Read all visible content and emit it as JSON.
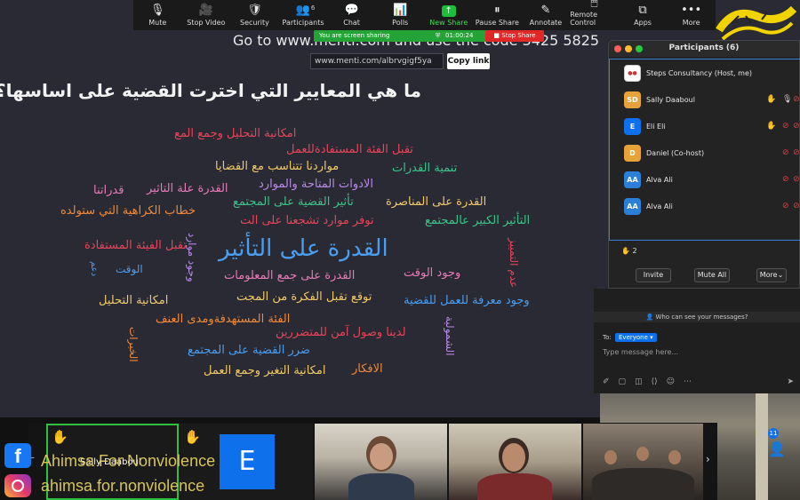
{
  "toolbar": {
    "items": [
      {
        "label": "Mute",
        "icon": "microphone-icon",
        "glyph": "🎙"
      },
      {
        "label": "Stop Video",
        "icon": "video-camera-icon",
        "glyph": "🎥"
      },
      {
        "label": "Security",
        "icon": "shield-icon",
        "glyph": "🛡"
      },
      {
        "label": "Participants",
        "icon": "participants-icon",
        "glyph": "👥",
        "badge": "6"
      },
      {
        "label": "Chat",
        "icon": "chat-bubble-icon",
        "glyph": "💬"
      },
      {
        "label": "Polls",
        "icon": "polls-icon",
        "glyph": "📊"
      },
      {
        "label": "New Share",
        "icon": "share-screen-icon",
        "glyph": "↑"
      },
      {
        "label": "Pause Share",
        "icon": "pause-icon",
        "glyph": "⏸"
      },
      {
        "label": "Annotate",
        "icon": "pencil-icon",
        "glyph": "✎"
      },
      {
        "label": "Remote Control",
        "icon": "remote-control-icon",
        "glyph": "🖱"
      },
      {
        "label": "Apps",
        "icon": "apps-icon",
        "glyph": "⧉"
      },
      {
        "label": "More",
        "icon": "more-dots-icon",
        "glyph": "•••"
      }
    ]
  },
  "share_bar": {
    "text": "You are screen sharing",
    "timer": "01:00:24",
    "stop_label": "Stop Share"
  },
  "slide": {
    "header": "Go to www.menti.com and use the code 3425 5825",
    "url": "www.menti.com/albrvgigf5ya",
    "copy_label": "Copy link",
    "question": "ما هي المعايير التي اخترت القضية على اساسها؟",
    "words": [
      {
        "text": "القدرة على التأثير",
        "color": "#4a9ef0"
      },
      {
        "text": "امكانية التحليل وجمع المع",
        "color": "#e8455a"
      },
      {
        "text": "تقبل الفئة المستفادةللعمل",
        "color": "#e8455a"
      },
      {
        "text": "مواردنا تتناسب مع القضايا",
        "color": "#f0c96a"
      },
      {
        "text": "تنمية القدرات",
        "color": "#3ec28a"
      },
      {
        "text": "الادوات المتاحة والموارد",
        "color": "#b88ae8"
      },
      {
        "text": "القدرة علة التاثير",
        "color": "#e87ab8"
      },
      {
        "text": "قدراتنا",
        "color": "#e87ab8"
      },
      {
        "text": "تأثير القضية على المجتمع",
        "color": "#3ec28a"
      },
      {
        "text": "القدرة على المناصرة",
        "color": "#f0c96a"
      },
      {
        "text": "خطاب الكراهية التي ستولده",
        "color": "#f08a3a"
      },
      {
        "text": "توفر موارد تشجعنا على الت",
        "color": "#e8455a"
      },
      {
        "text": "التأثير الكبير عالمجتمع",
        "color": "#3ec28a"
      },
      {
        "text": "القدرة على التأثير",
        "color": "#4a9ef0"
      },
      {
        "text": "تقبل الفيئة المستفادة",
        "color": "#e8455a"
      },
      {
        "text": "وجود موارد",
        "color": "#b88ae8"
      },
      {
        "text": "عدم التمييز",
        "color": "#e8455a"
      },
      {
        "text": "الوقت",
        "color": "#4a9ef0"
      },
      {
        "text": "دعم",
        "color": "#4a9ef0"
      },
      {
        "text": "القدرة على جمع المعلومات",
        "color": "#e87ab8"
      },
      {
        "text": "وجود الوقت",
        "color": "#e87ab8"
      },
      {
        "text": "امكانية التحليل",
        "color": "#f0c96a"
      },
      {
        "text": "توقع تقبل الفكرة من المجت",
        "color": "#f0c96a"
      },
      {
        "text": "وجود معرفة للعمل للقضية",
        "color": "#4a9ef0"
      },
      {
        "text": "الفئة المستهدفةومدى العنف",
        "color": "#f08a3a"
      },
      {
        "text": "لدينا وصول آمن للمتضررين",
        "color": "#e8455a"
      },
      {
        "text": "الشمولية",
        "color": "#b88ae8"
      },
      {
        "text": "الخبرات",
        "color": "#f08a3a"
      },
      {
        "text": "ضرر القضية على المجتمع",
        "color": "#4a9ef0"
      },
      {
        "text": "امكانية التغير وجمع العمل",
        "color": "#f0c96a"
      },
      {
        "text": "الافكار",
        "color": "#f08a3a"
      }
    ]
  },
  "participants": {
    "title": "Participants (6)",
    "list": [
      {
        "name": "Steps Consultancy (Host, me)",
        "initials": "",
        "color": "#ffffff"
      },
      {
        "name": "Sally Daaboul",
        "initials": "SD",
        "color": "#e8a23a"
      },
      {
        "name": "Eli Eli",
        "initials": "E",
        "color": "#0e71eb"
      },
      {
        "name": "Daniel (Co-host)",
        "initials": "D",
        "color": "#e8a23a"
      },
      {
        "name": "Alva Ali",
        "initials": "AA",
        "color": "#2b7fd6"
      },
      {
        "name": "Alva Ali",
        "initials": "AA",
        "color": "#2b7fd6"
      }
    ],
    "raised_count": "2",
    "invite_label": "Invite",
    "mute_all_label": "Mute All",
    "more_label": "More"
  },
  "chat": {
    "visibility": "Who can see your messages?",
    "to_label": "To:",
    "recipient": "Everyone",
    "placeholder": "Type message here..."
  },
  "video": {
    "sally_name": "Sally Daaboul",
    "eli_initial": "E",
    "photo_badge": "11"
  },
  "brand": {
    "facebook": "Ahimsa For Nonviolence",
    "instagram": "ahimsa.for.nonviolence",
    "facebook_glyph": "f"
  }
}
